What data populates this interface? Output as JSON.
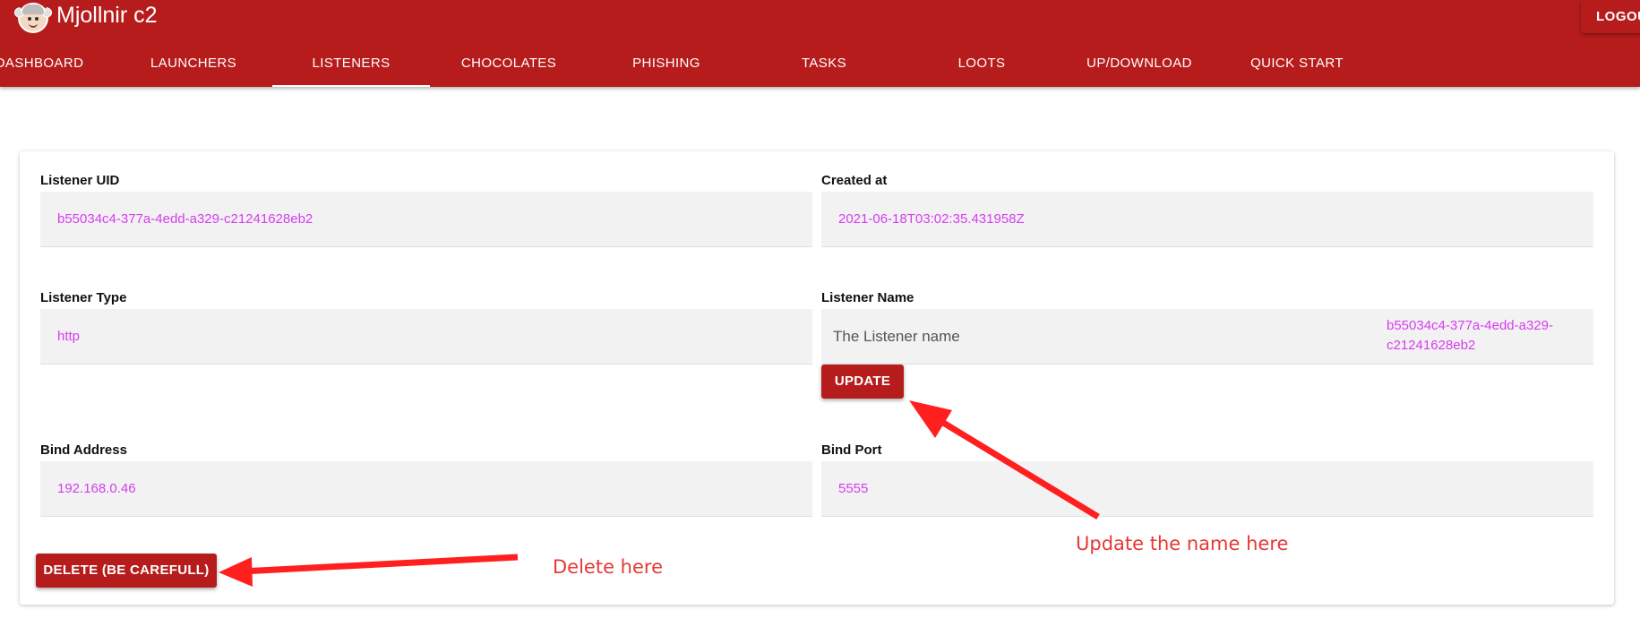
{
  "app": {
    "title": "Mjollnir c2",
    "logout_label": "LOGOUT"
  },
  "nav": {
    "tabs": [
      {
        "label": "DASHBOARD"
      },
      {
        "label": "LAUNCHERS"
      },
      {
        "label": "LISTENERS",
        "active": true
      },
      {
        "label": "CHOCOLATES"
      },
      {
        "label": "PHISHING"
      },
      {
        "label": "TASKS"
      },
      {
        "label": "LOOTS"
      },
      {
        "label": "UP/DOWNLOAD"
      },
      {
        "label": "QUICK START"
      }
    ]
  },
  "listener": {
    "uid": {
      "label": "Listener UID",
      "value": "b55034c4-377a-4edd-a329-c21241628eb2"
    },
    "created": {
      "label": "Created at",
      "value": "2021-06-18T03:02:35.431958Z"
    },
    "type": {
      "label": "Listener Type",
      "value": "http"
    },
    "name": {
      "label": "Listener Name",
      "input_value": "The Listener name",
      "side_value": "b55034c4-377a-4edd-a329-c21241628eb2"
    },
    "bind_address": {
      "label": "Bind Address",
      "value": "192.168.0.46"
    },
    "bind_port": {
      "label": "Bind Port",
      "value": "5555"
    },
    "update_label": "UPDATE",
    "delete_label": "DELETE (BE CAREFULL)"
  },
  "annotations": {
    "update_note": "Update the name here",
    "delete_note": "Delete here"
  },
  "colors": {
    "brand": "#b71c1c",
    "value_text": "#d63df0",
    "annotation": "#e53935"
  }
}
